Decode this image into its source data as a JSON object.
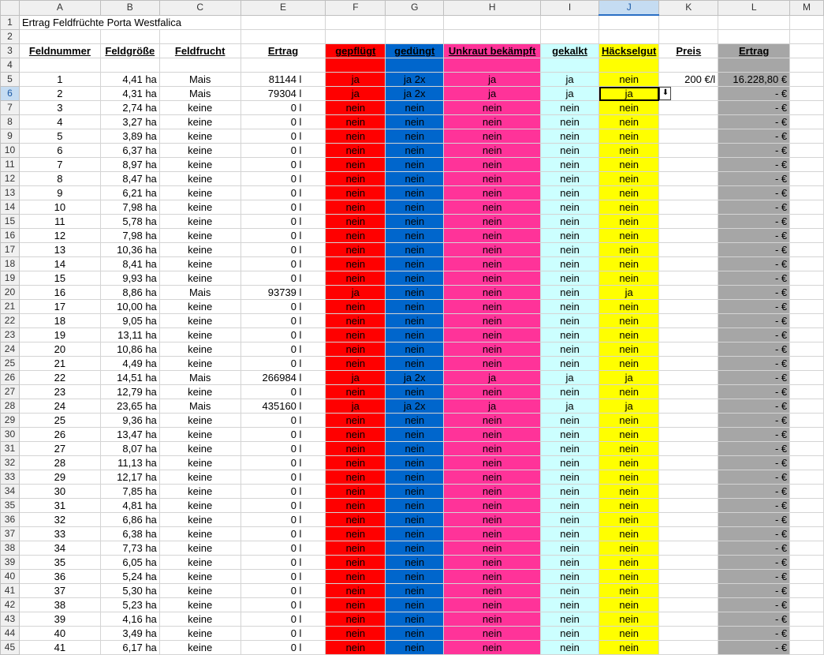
{
  "colors": {
    "gepfluegt": "#ff0000",
    "geduengt": "#0066cc",
    "unkraut": "#ff3399",
    "gekalkt": "#ccffff",
    "haeckselgut": "#ffff00",
    "ertrag_total": "#a6a6a6"
  },
  "columns": [
    "A",
    "B",
    "C",
    "E",
    "F",
    "G",
    "H",
    "I",
    "J",
    "K",
    "L",
    "M"
  ],
  "active_column": "J",
  "active_row": "6",
  "title": "Ertrag Feldfrüchte Porta Westfalica",
  "headers": {
    "feldnummer": "Feldnummer",
    "feldgroesse": "Feldgröße",
    "feldfrucht": "Feldfrucht",
    "ertrag": "Ertrag",
    "gepfluegt": "gepflügt",
    "geduengt": "gedüngt",
    "unkraut": "Unkraut bekämpft",
    "gekalkt": "gekalkt",
    "haeckselgut": "Häckselgut",
    "preis": "Preis",
    "ertrag_total": "Ertrag"
  },
  "price": "200 €/l",
  "dropdown_icon": "arrow-down-icon",
  "rows": [
    {
      "num": "1",
      "size": "4,41 ha",
      "crop": "Mais",
      "yield": "81144 l",
      "f": "ja",
      "g": "ja 2x",
      "h": "ja",
      "i": "ja",
      "j": "nein",
      "total": "16.228,80 €"
    },
    {
      "num": "2",
      "size": "4,31 ha",
      "crop": "Mais",
      "yield": "79304 l",
      "f": "ja",
      "g": "ja 2x",
      "h": "ja",
      "i": "ja",
      "j": "ja",
      "total": "- €"
    },
    {
      "num": "3",
      "size": "2,74 ha",
      "crop": "keine",
      "yield": "0 l",
      "f": "nein",
      "g": "nein",
      "h": "nein",
      "i": "nein",
      "j": "nein",
      "total": "- €"
    },
    {
      "num": "4",
      "size": "3,27 ha",
      "crop": "keine",
      "yield": "0 l",
      "f": "nein",
      "g": "nein",
      "h": "nein",
      "i": "nein",
      "j": "nein",
      "total": "- €"
    },
    {
      "num": "5",
      "size": "3,89 ha",
      "crop": "keine",
      "yield": "0 l",
      "f": "nein",
      "g": "nein",
      "h": "nein",
      "i": "nein",
      "j": "nein",
      "total": "- €"
    },
    {
      "num": "6",
      "size": "6,37 ha",
      "crop": "keine",
      "yield": "0 l",
      "f": "nein",
      "g": "nein",
      "h": "nein",
      "i": "nein",
      "j": "nein",
      "total": "- €"
    },
    {
      "num": "7",
      "size": "8,97 ha",
      "crop": "keine",
      "yield": "0 l",
      "f": "nein",
      "g": "nein",
      "h": "nein",
      "i": "nein",
      "j": "nein",
      "total": "- €"
    },
    {
      "num": "8",
      "size": "8,47 ha",
      "crop": "keine",
      "yield": "0 l",
      "f": "nein",
      "g": "nein",
      "h": "nein",
      "i": "nein",
      "j": "nein",
      "total": "- €"
    },
    {
      "num": "9",
      "size": "6,21 ha",
      "crop": "keine",
      "yield": "0 l",
      "f": "nein",
      "g": "nein",
      "h": "nein",
      "i": "nein",
      "j": "nein",
      "total": "- €"
    },
    {
      "num": "10",
      "size": "7,98 ha",
      "crop": "keine",
      "yield": "0 l",
      "f": "nein",
      "g": "nein",
      "h": "nein",
      "i": "nein",
      "j": "nein",
      "total": "- €"
    },
    {
      "num": "11",
      "size": "5,78 ha",
      "crop": "keine",
      "yield": "0 l",
      "f": "nein",
      "g": "nein",
      "h": "nein",
      "i": "nein",
      "j": "nein",
      "total": "- €"
    },
    {
      "num": "12",
      "size": "7,98 ha",
      "crop": "keine",
      "yield": "0 l",
      "f": "nein",
      "g": "nein",
      "h": "nein",
      "i": "nein",
      "j": "nein",
      "total": "- €"
    },
    {
      "num": "13",
      "size": "10,36 ha",
      "crop": "keine",
      "yield": "0 l",
      "f": "nein",
      "g": "nein",
      "h": "nein",
      "i": "nein",
      "j": "nein",
      "total": "- €"
    },
    {
      "num": "14",
      "size": "8,41 ha",
      "crop": "keine",
      "yield": "0 l",
      "f": "nein",
      "g": "nein",
      "h": "nein",
      "i": "nein",
      "j": "nein",
      "total": "- €"
    },
    {
      "num": "15",
      "size": "9,93 ha",
      "crop": "keine",
      "yield": "0 l",
      "f": "nein",
      "g": "nein",
      "h": "nein",
      "i": "nein",
      "j": "nein",
      "total": "- €"
    },
    {
      "num": "16",
      "size": "8,86 ha",
      "crop": "Mais",
      "yield": "93739 l",
      "f": "ja",
      "g": "nein",
      "h": "nein",
      "i": "nein",
      "j": "ja",
      "total": "- €"
    },
    {
      "num": "17",
      "size": "10,00 ha",
      "crop": "keine",
      "yield": "0 l",
      "f": "nein",
      "g": "nein",
      "h": "nein",
      "i": "nein",
      "j": "nein",
      "total": "- €"
    },
    {
      "num": "18",
      "size": "9,05 ha",
      "crop": "keine",
      "yield": "0 l",
      "f": "nein",
      "g": "nein",
      "h": "nein",
      "i": "nein",
      "j": "nein",
      "total": "- €"
    },
    {
      "num": "19",
      "size": "13,11 ha",
      "crop": "keine",
      "yield": "0 l",
      "f": "nein",
      "g": "nein",
      "h": "nein",
      "i": "nein",
      "j": "nein",
      "total": "- €"
    },
    {
      "num": "20",
      "size": "10,86 ha",
      "crop": "keine",
      "yield": "0 l",
      "f": "nein",
      "g": "nein",
      "h": "nein",
      "i": "nein",
      "j": "nein",
      "total": "- €"
    },
    {
      "num": "21",
      "size": "4,49 ha",
      "crop": "keine",
      "yield": "0 l",
      "f": "nein",
      "g": "nein",
      "h": "nein",
      "i": "nein",
      "j": "nein",
      "total": "- €"
    },
    {
      "num": "22",
      "size": "14,51 ha",
      "crop": "Mais",
      "yield": "266984 l",
      "f": "ja",
      "g": "ja 2x",
      "h": "ja",
      "i": "ja",
      "j": "ja",
      "total": "- €"
    },
    {
      "num": "23",
      "size": "12,79 ha",
      "crop": "keine",
      "yield": "0 l",
      "f": "nein",
      "g": "nein",
      "h": "nein",
      "i": "nein",
      "j": "nein",
      "total": "- €"
    },
    {
      "num": "24",
      "size": "23,65 ha",
      "crop": "Mais",
      "yield": "435160 l",
      "f": "ja",
      "g": "ja 2x",
      "h": "ja",
      "i": "ja",
      "j": "ja",
      "total": "- €"
    },
    {
      "num": "25",
      "size": "9,36 ha",
      "crop": "keine",
      "yield": "0 l",
      "f": "nein",
      "g": "nein",
      "h": "nein",
      "i": "nein",
      "j": "nein",
      "total": "- €"
    },
    {
      "num": "26",
      "size": "13,47 ha",
      "crop": "keine",
      "yield": "0 l",
      "f": "nein",
      "g": "nein",
      "h": "nein",
      "i": "nein",
      "j": "nein",
      "total": "- €"
    },
    {
      "num": "27",
      "size": "8,07 ha",
      "crop": "keine",
      "yield": "0 l",
      "f": "nein",
      "g": "nein",
      "h": "nein",
      "i": "nein",
      "j": "nein",
      "total": "- €"
    },
    {
      "num": "28",
      "size": "11,13 ha",
      "crop": "keine",
      "yield": "0 l",
      "f": "nein",
      "g": "nein",
      "h": "nein",
      "i": "nein",
      "j": "nein",
      "total": "- €"
    },
    {
      "num": "29",
      "size": "12,17 ha",
      "crop": "keine",
      "yield": "0 l",
      "f": "nein",
      "g": "nein",
      "h": "nein",
      "i": "nein",
      "j": "nein",
      "total": "- €"
    },
    {
      "num": "30",
      "size": "7,85 ha",
      "crop": "keine",
      "yield": "0 l",
      "f": "nein",
      "g": "nein",
      "h": "nein",
      "i": "nein",
      "j": "nein",
      "total": "- €"
    },
    {
      "num": "31",
      "size": "4,81 ha",
      "crop": "keine",
      "yield": "0 l",
      "f": "nein",
      "g": "nein",
      "h": "nein",
      "i": "nein",
      "j": "nein",
      "total": "- €"
    },
    {
      "num": "32",
      "size": "6,86 ha",
      "crop": "keine",
      "yield": "0 l",
      "f": "nein",
      "g": "nein",
      "h": "nein",
      "i": "nein",
      "j": "nein",
      "total": "- €"
    },
    {
      "num": "33",
      "size": "6,38 ha",
      "crop": "keine",
      "yield": "0 l",
      "f": "nein",
      "g": "nein",
      "h": "nein",
      "i": "nein",
      "j": "nein",
      "total": "- €"
    },
    {
      "num": "34",
      "size": "7,73 ha",
      "crop": "keine",
      "yield": "0 l",
      "f": "nein",
      "g": "nein",
      "h": "nein",
      "i": "nein",
      "j": "nein",
      "total": "- €"
    },
    {
      "num": "35",
      "size": "6,05 ha",
      "crop": "keine",
      "yield": "0 l",
      "f": "nein",
      "g": "nein",
      "h": "nein",
      "i": "nein",
      "j": "nein",
      "total": "- €"
    },
    {
      "num": "36",
      "size": "5,24 ha",
      "crop": "keine",
      "yield": "0 l",
      "f": "nein",
      "g": "nein",
      "h": "nein",
      "i": "nein",
      "j": "nein",
      "total": "- €"
    },
    {
      "num": "37",
      "size": "5,30 ha",
      "crop": "keine",
      "yield": "0 l",
      "f": "nein",
      "g": "nein",
      "h": "nein",
      "i": "nein",
      "j": "nein",
      "total": "- €"
    },
    {
      "num": "38",
      "size": "5,23 ha",
      "crop": "keine",
      "yield": "0 l",
      "f": "nein",
      "g": "nein",
      "h": "nein",
      "i": "nein",
      "j": "nein",
      "total": "- €"
    },
    {
      "num": "39",
      "size": "4,16 ha",
      "crop": "keine",
      "yield": "0 l",
      "f": "nein",
      "g": "nein",
      "h": "nein",
      "i": "nein",
      "j": "nein",
      "total": "- €"
    },
    {
      "num": "40",
      "size": "3,49 ha",
      "crop": "keine",
      "yield": "0 l",
      "f": "nein",
      "g": "nein",
      "h": "nein",
      "i": "nein",
      "j": "nein",
      "total": "- €"
    },
    {
      "num": "41",
      "size": "6,17 ha",
      "crop": "keine",
      "yield": "0 l",
      "f": "nein",
      "g": "nein",
      "h": "nein",
      "i": "nein",
      "j": "nein",
      "total": "- €"
    }
  ]
}
